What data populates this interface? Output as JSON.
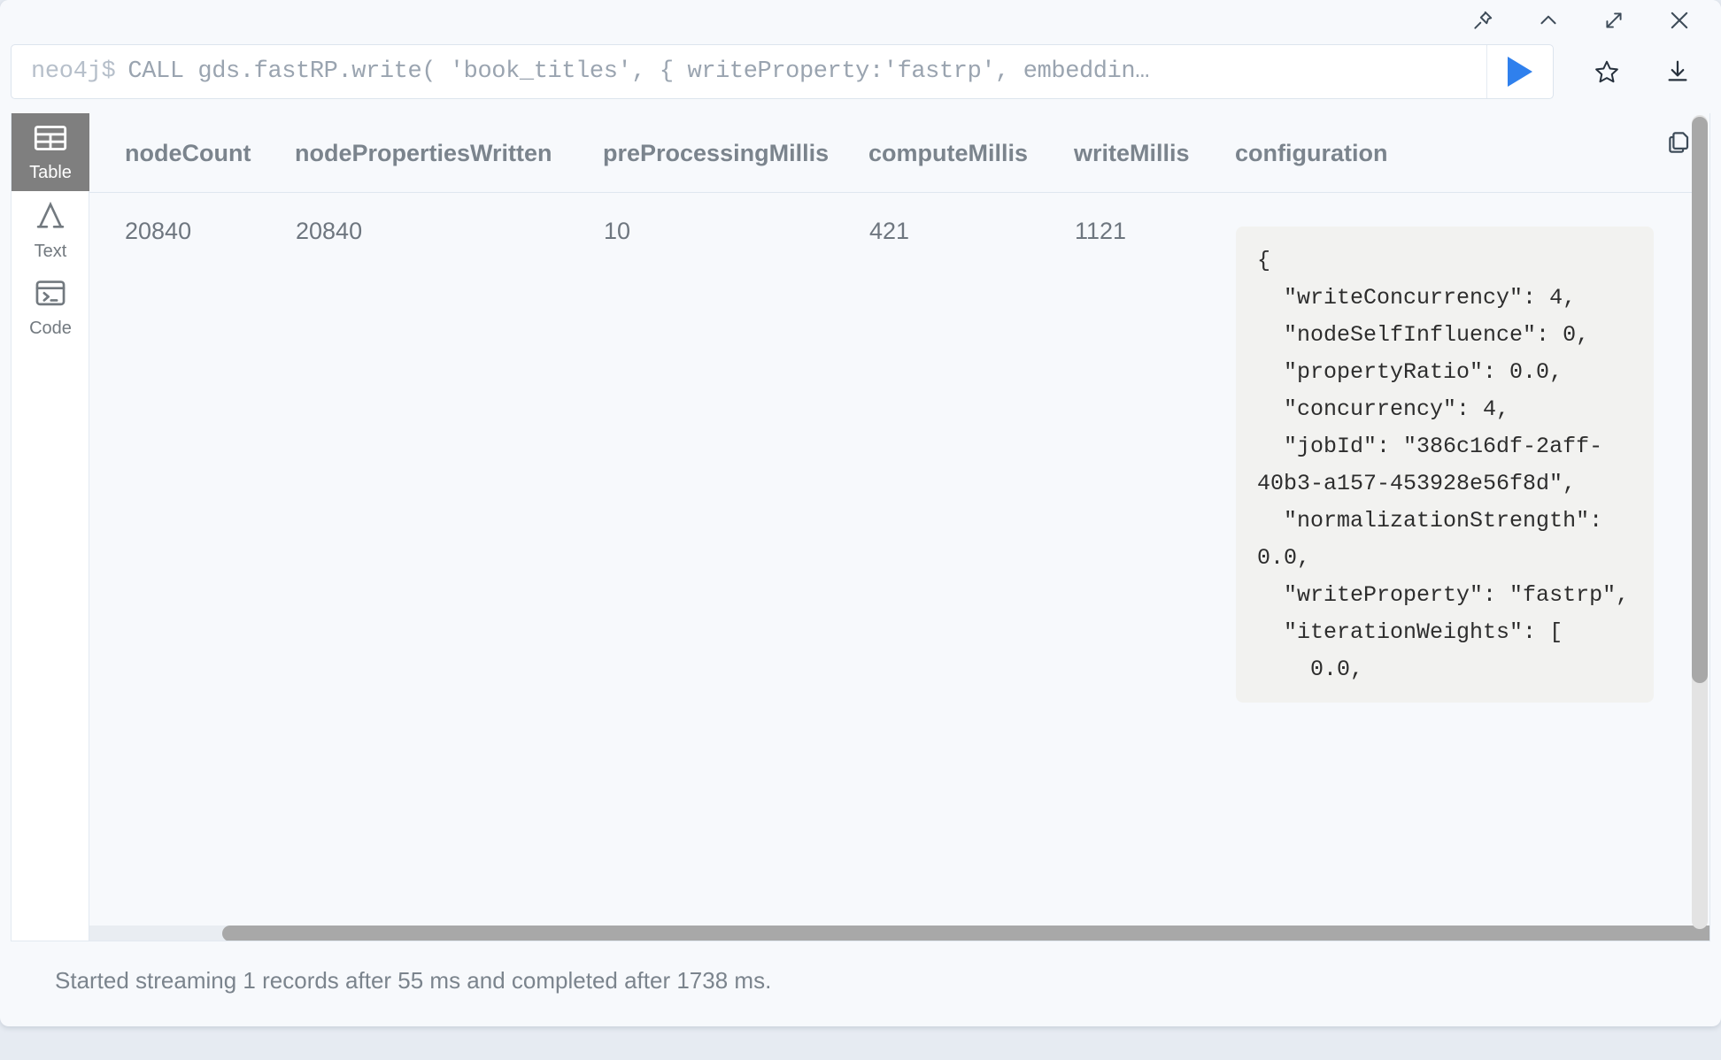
{
  "window": {
    "controls": [
      {
        "name": "pin",
        "label": "Pin"
      },
      {
        "name": "collapse",
        "label": "Collapse"
      },
      {
        "name": "expand",
        "label": "Expand"
      },
      {
        "name": "close",
        "label": "Close"
      }
    ]
  },
  "query_bar": {
    "prompt": "neo4j$",
    "query": "CALL gds.fastRP.write( 'book_titles', { writeProperty:'fastrp', embeddin…",
    "run_label": "Run",
    "favorite_label": "Save as favorite",
    "download_label": "Download"
  },
  "view_switcher": {
    "items": [
      {
        "id": "table",
        "label": "Table",
        "icon": "table-icon",
        "active": true
      },
      {
        "id": "text",
        "label": "Text",
        "icon": "text-icon",
        "active": false
      },
      {
        "id": "code",
        "label": "Code",
        "icon": "code-icon",
        "active": false
      }
    ]
  },
  "table": {
    "columns": [
      "nodeCount",
      "nodePropertiesWritten",
      "preProcessingMillis",
      "computeMillis",
      "writeMillis",
      "configuration"
    ],
    "rows": [
      {
        "nodeCount": "20840",
        "nodePropertiesWritten": "20840",
        "preProcessingMillis": "10",
        "computeMillis": "421",
        "writeMillis": "1121",
        "configuration": "{\n  \"writeConcurrency\": 4,\n  \"nodeSelfInfluence\": 0,\n  \"propertyRatio\": 0.0,\n  \"concurrency\": 4,\n  \"jobId\": \"386c16df-2aff-40b3-a157-453928e56f8d\",\n  \"normalizationStrength\": 0.0,\n  \"writeProperty\": \"fastrp\",\n  \"iterationWeights\": [\n    0.0,"
      }
    ],
    "copy_label": "Copy"
  },
  "status": {
    "message": "Started streaming 1 records after 55 ms and completed after 1738 ms."
  },
  "colors": {
    "accent": "#2f80ed",
    "page_background": "#e6ebf2",
    "panel_background": "#f7f9fc",
    "active_tab": "#7f7f7f",
    "json_background": "#f2f2f0",
    "scrollbar_thumb": "#a8a8a8"
  }
}
